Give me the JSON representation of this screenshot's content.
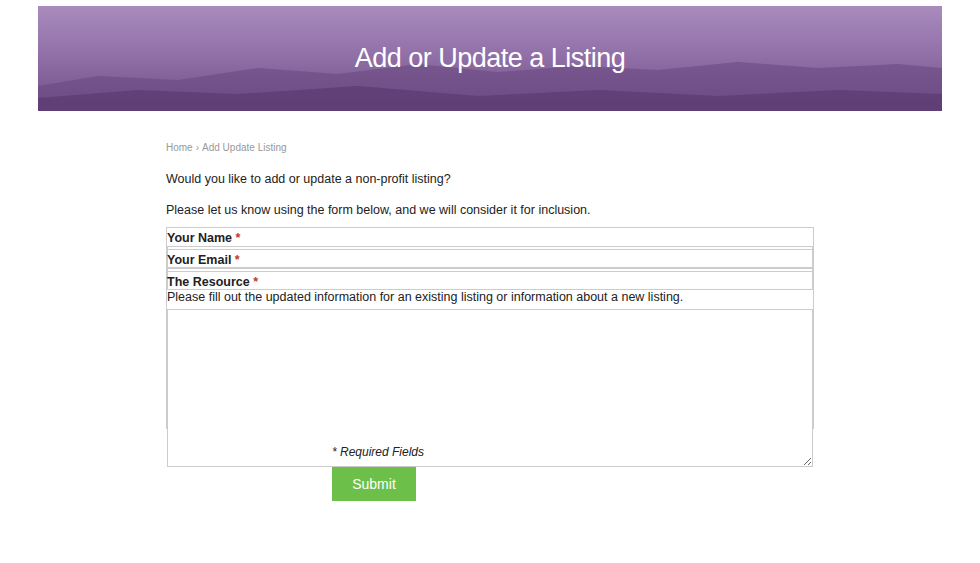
{
  "banner": {
    "title": "Add or Update a Listing"
  },
  "breadcrumb": {
    "items": [
      "Home",
      "Add Update Listing"
    ],
    "separator": "›"
  },
  "intro": [
    "Would you like to add or update a non-profit listing?",
    "Please let us know using the form below, and we will consider it for inclusion."
  ],
  "form": {
    "required_mark": "*",
    "fields": [
      {
        "label": "Your Name",
        "required": true,
        "kind": "input",
        "help": ""
      },
      {
        "label": "Your Email",
        "required": true,
        "kind": "input",
        "help": ""
      },
      {
        "label": "The Resource",
        "required": true,
        "kind": "textarea",
        "help": "Please fill out the updated information for an existing listing or information about a new listing."
      }
    ],
    "required_note": "* Required Fields",
    "submit": "Submit"
  }
}
